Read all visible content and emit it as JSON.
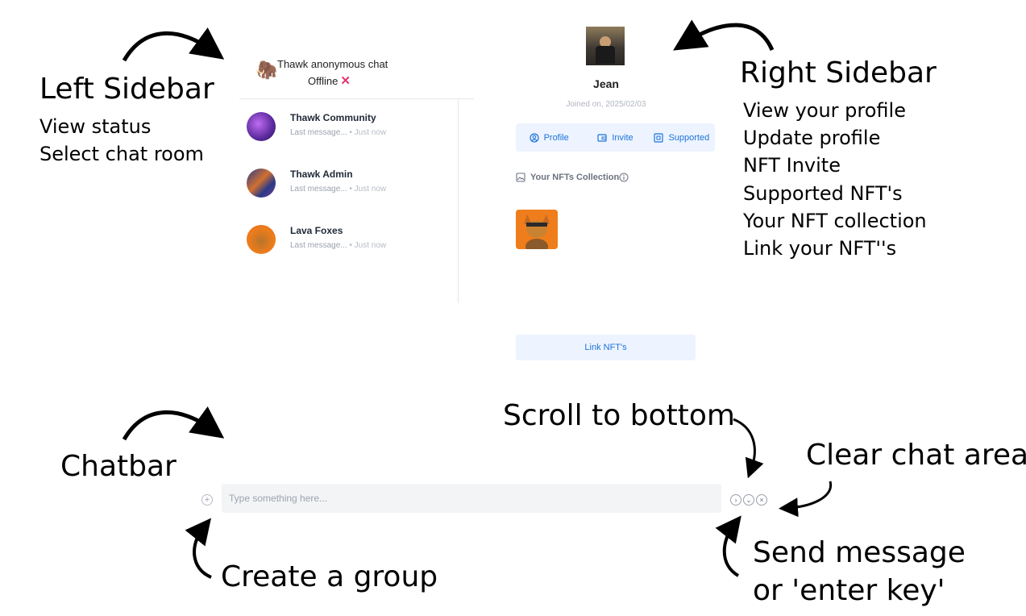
{
  "annotations": {
    "left_sidebar_title": "Left Sidebar",
    "left_sidebar_lines": [
      "View status",
      "Select chat room"
    ],
    "right_sidebar_title": "Right Sidebar",
    "right_sidebar_lines": [
      "View your profile",
      "Update profile",
      "NFT Invite",
      "Supported NFT's",
      "Your NFT collection",
      "Link your NFT''s"
    ],
    "chatbar": "Chatbar",
    "scroll_to_bottom": "Scroll to bottom",
    "clear_chat_area": "Clear chat area",
    "create_group": "Create a group",
    "send_message_1": "Send message",
    "send_message_2": "or 'enter key'"
  },
  "left_sidebar": {
    "title": "Thawk anonymous chat",
    "status": "Offline",
    "status_icon": "cross-mark-icon",
    "chats": [
      {
        "name": "Thawk Community",
        "last_message": "Last message...",
        "time": "• Just now",
        "avatar_color": "#7b3fc4"
      },
      {
        "name": "Thawk Admin",
        "last_message": "Last message...",
        "time": "• Just now",
        "avatar_color": "#3b4a9a"
      },
      {
        "name": "Lava Foxes",
        "last_message": "Last message...",
        "time": "• Just now",
        "avatar_color": "#ef7d1b"
      }
    ]
  },
  "right_sidebar": {
    "name": "Jean",
    "joined": "Joined on, 2025/02/03",
    "tabs": [
      {
        "label": "Profile",
        "icon": "user-circle-icon"
      },
      {
        "label": "Invite",
        "icon": "wallet-icon"
      },
      {
        "label": "Supported",
        "icon": "grid-icon"
      }
    ],
    "nfts_label": "Your NFTs Collection",
    "link_button": "Link NFT's"
  },
  "chatbar": {
    "placeholder": "Type something here..."
  },
  "colors": {
    "accent": "#1d72d8",
    "tab_bg": "#edf4ff",
    "offline_x": "#e3356a"
  }
}
